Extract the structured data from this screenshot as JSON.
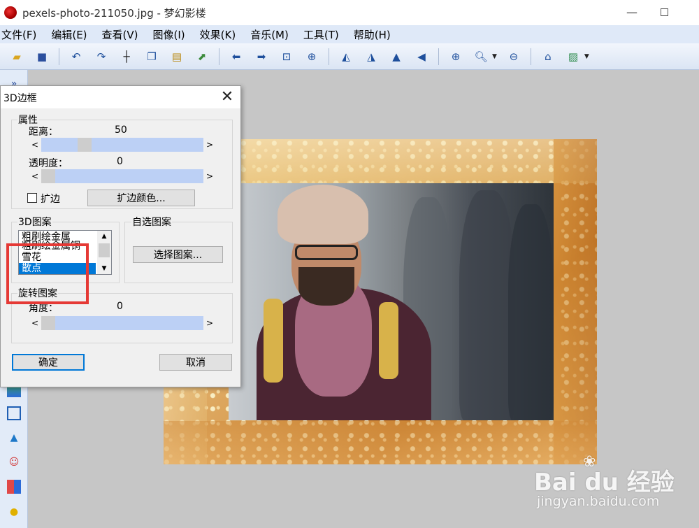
{
  "window": {
    "title": "pexels-photo-211050.jpg - 梦幻影楼",
    "minimize": "—"
  },
  "menu": [
    "文件(F)",
    "编辑(E)",
    "查看(V)",
    "图像(I)",
    "效果(K)",
    "音乐(M)",
    "工具(T)",
    "帮助(H)"
  ],
  "toolbar": {
    "icons": [
      "open-folder-icon",
      "save-icon",
      "undo-icon",
      "redo-icon",
      "crop-icon",
      "copy-icon",
      "paste-icon",
      "export-icon",
      "arrow-left-icon",
      "arrow-right-icon",
      "fit-window-icon",
      "capture-icon",
      "flip-left-icon",
      "flip-right-icon",
      "mirror-icon",
      "rotate-icon",
      "zoom-in-icon",
      "zoom-icon",
      "zoom-out-icon",
      "home-icon",
      "image-icon"
    ]
  },
  "left_tools": [
    "next-icon",
    "color-bar-icon",
    "frame-tool-icon",
    "triangle-icon",
    "mask-icon",
    "grid-icon",
    "bulb-icon"
  ],
  "dialog": {
    "title": "3D边框",
    "close": "✕",
    "properties": {
      "group_title": "属性",
      "distance_label": "距离：",
      "distance_value": "50",
      "opacity_label": "透明度：",
      "opacity_value": "0",
      "expand_label": "扩边",
      "expand_checked": false,
      "expand_color_button": "扩边颜色..."
    },
    "patterns": {
      "group_title": "3D图案",
      "items": [
        "粗刷绘金属",
        "粗刷绘金属铜",
        "雪花",
        "散点"
      ],
      "selected": "散点"
    },
    "custom_pattern": {
      "group_title": "自选图案",
      "button": "选择图案..."
    },
    "rotate": {
      "group_title": "旋转图案",
      "angle_label": "角度：",
      "angle_value": "0"
    },
    "ok_button": "确定",
    "cancel_button": "取消"
  },
  "watermark": {
    "logo": "Bai du 经验",
    "url": "jingyan.baidu.com"
  },
  "colors": {
    "menubar_bg": "#dfe9f8",
    "workspace_bg": "#c6c6c6",
    "selection": "#0078d7",
    "slider_track": "#bcd0f5",
    "annotation": "#e53935"
  }
}
